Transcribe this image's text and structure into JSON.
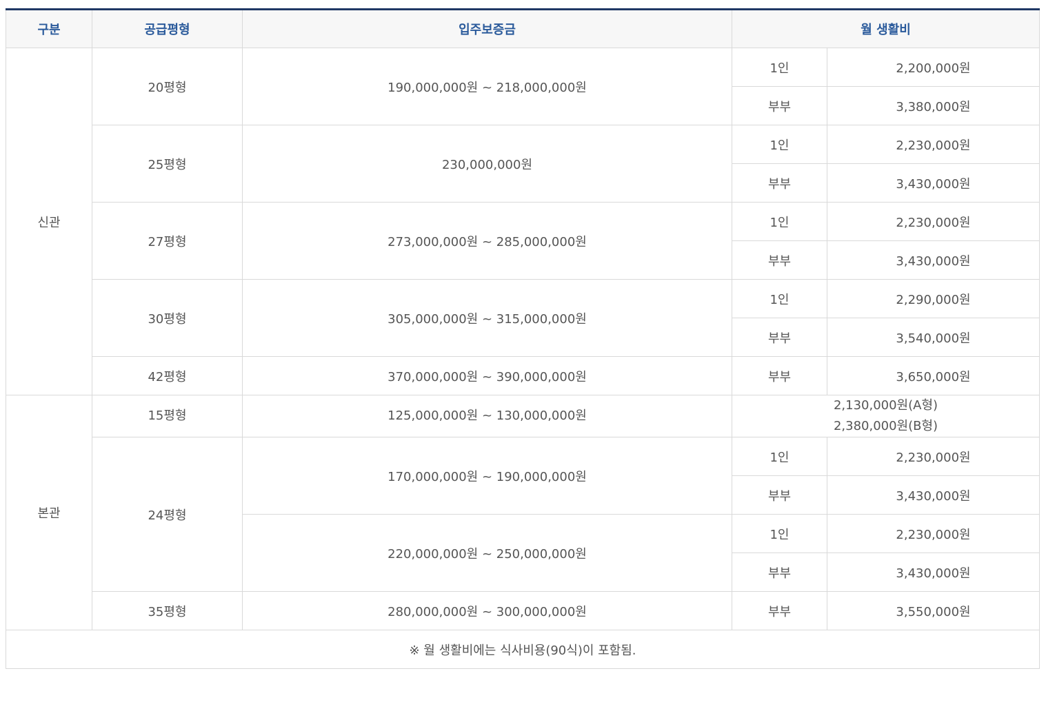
{
  "headers": {
    "division": "구분",
    "type": "공급평형",
    "deposit": "입주보증금",
    "monthly": "월 생활비"
  },
  "new_wing": {
    "label": "신관",
    "rows": [
      {
        "type": "20평형",
        "deposit": "190,000,000원 ~ 218,000,000원",
        "fees": [
          {
            "who": "1인",
            "amount": "2,200,000원"
          },
          {
            "who": "부부",
            "amount": "3,380,000원"
          }
        ]
      },
      {
        "type": "25평형",
        "deposit": "230,000,000원",
        "fees": [
          {
            "who": "1인",
            "amount": "2,230,000원"
          },
          {
            "who": "부부",
            "amount": "3,430,000원"
          }
        ]
      },
      {
        "type": "27평형",
        "deposit": "273,000,000원 ~ 285,000,000원",
        "fees": [
          {
            "who": "1인",
            "amount": "2,230,000원"
          },
          {
            "who": "부부",
            "amount": "3,430,000원"
          }
        ]
      },
      {
        "type": "30평형",
        "deposit": "305,000,000원 ~ 315,000,000원",
        "fees": [
          {
            "who": "1인",
            "amount": "2,290,000원"
          },
          {
            "who": "부부",
            "amount": "3,540,000원"
          }
        ]
      },
      {
        "type": "42평형",
        "deposit": "370,000,000원 ~ 390,000,000원",
        "fees": [
          {
            "who": "부부",
            "amount": "3,650,000원"
          }
        ]
      }
    ]
  },
  "main_wing": {
    "label": "본관",
    "row15": {
      "type": "15평형",
      "deposit": "125,000,000원 ~ 130,000,000원",
      "fee_a": "2,130,000원(A형)",
      "fee_b": "2,380,000원(B형)"
    },
    "row24": {
      "type": "24평형",
      "options": [
        {
          "deposit": "170,000,000원 ~ 190,000,000원",
          "fees": [
            {
              "who": "1인",
              "amount": "2,230,000원"
            },
            {
              "who": "부부",
              "amount": "3,430,000원"
            }
          ]
        },
        {
          "deposit": "220,000,000원 ~ 250,000,000원",
          "fees": [
            {
              "who": "1인",
              "amount": "2,230,000원"
            },
            {
              "who": "부부",
              "amount": "3,430,000원"
            }
          ]
        }
      ]
    },
    "row35": {
      "type": "35평형",
      "deposit": "280,000,000원 ~ 300,000,000원",
      "fees": [
        {
          "who": "부부",
          "amount": "3,550,000원"
        }
      ]
    }
  },
  "note": "※ 월 생활비에는 식사비용(90식)이 포함됨."
}
